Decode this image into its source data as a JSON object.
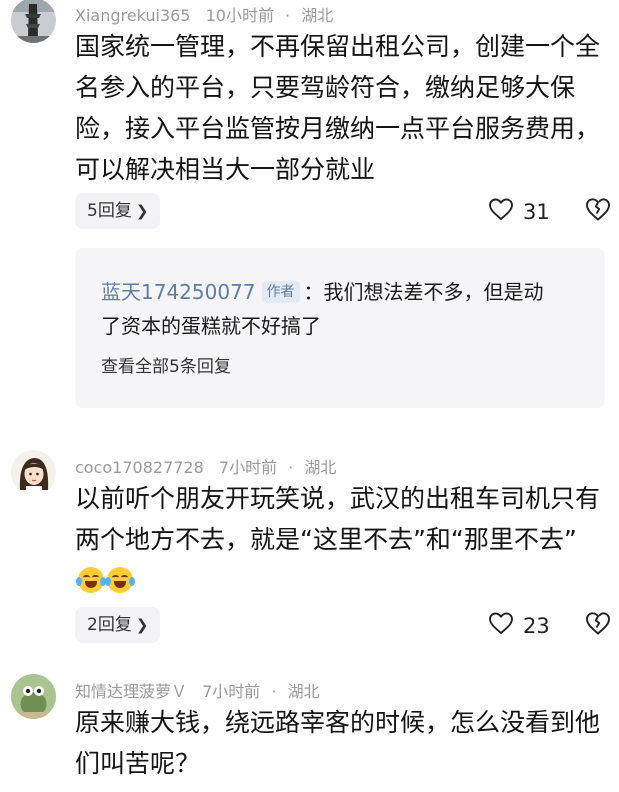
{
  "comments": [
    {
      "username": "Xiangrekui365",
      "time": "10小时前",
      "location": "湖北",
      "text": "国家统一管理，不再保留出租公司，创建一个全名参入的平台，只要驾龄符合，缴纳足够大保险，接入平台监管按月缴纳一点平台服务费用，可以解决相当大一部分就业",
      "reply_count_label": "5回复",
      "likes": "31",
      "thread": {
        "author": "蓝天174250077",
        "author_tag": "作者",
        "reply_line1": "：我们想法差不多，但是动",
        "reply_line2": "了资本的蛋糕就不好搞了",
        "view_all": "查看全部5条回复"
      }
    },
    {
      "username": "coco170827728",
      "time": "7小时前",
      "location": "湖北",
      "text": "以前听个朋友开玩笑说，武汉的出租车司机只有两个地方不去，就是“这里不去”和“那里不去”",
      "emojis": [
        "laugh-cry-emoji",
        "laugh-cry-emoji"
      ],
      "reply_count_label": "2回复",
      "likes": "23"
    },
    {
      "username": "知情达理菠萝Ｖ",
      "time": "7小时前",
      "location": "湖北",
      "text": "原来赚大钱，绕远路宰客的时候，怎么没看到他们叫苦呢？"
    }
  ],
  "icons": {
    "like": "heart-outline-icon",
    "dislike": "broken-heart-icon",
    "chevron": "chevron-right-icon"
  },
  "colors": {
    "meta_gray": "#9a9a9a",
    "author_blue": "#5d7ea3",
    "pill_bg": "#f3f3f5",
    "thread_bg": "#f5f5f7"
  }
}
